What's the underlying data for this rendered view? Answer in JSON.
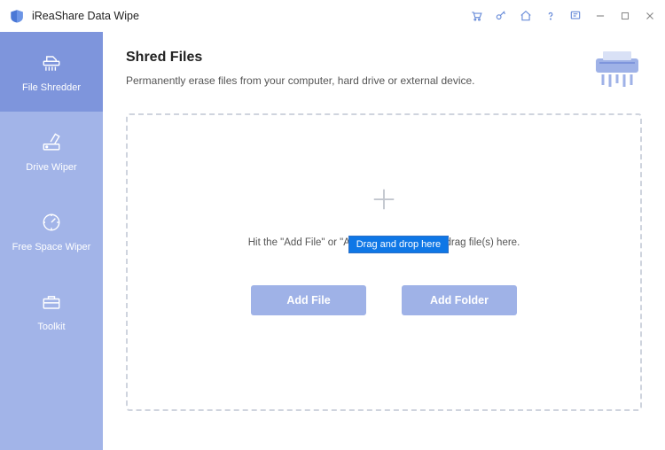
{
  "titlebar": {
    "app_title": "iReaShare Data Wipe",
    "icons": {
      "cart": "cart-icon",
      "key": "key-icon",
      "home": "home-icon",
      "help": "help-icon",
      "feedback": "feedback-icon",
      "minimize": "minimize-icon",
      "maximize": "maximize-icon",
      "close": "close-icon"
    }
  },
  "sidebar": {
    "items": [
      {
        "label": "File Shredder",
        "icon": "shredder-icon"
      },
      {
        "label": "Drive Wiper",
        "icon": "drive-wiper-icon"
      },
      {
        "label": "Free Space Wiper",
        "icon": "free-space-icon"
      },
      {
        "label": "Toolkit",
        "icon": "toolkit-icon"
      }
    ]
  },
  "main": {
    "title": "Shred Files",
    "subtitle": "Permanently erase files from your computer, hard drive or external device.",
    "hint": "Hit the \"Add File\" or \"Add Folder\" button, or drag file(s) here.",
    "tooltip": "Drag and drop here",
    "add_file_label": "Add File",
    "add_folder_label": "Add Folder"
  }
}
